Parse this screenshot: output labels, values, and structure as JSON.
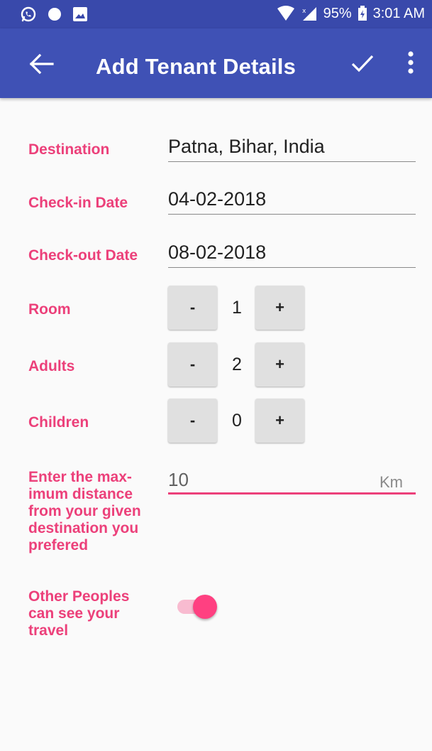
{
  "status_bar": {
    "battery": "95%",
    "time": "3:01 AM"
  },
  "toolbar": {
    "title": "Add Tenant Details"
  },
  "form": {
    "destination": {
      "label": "Destination",
      "value": "Patna, Bihar, India"
    },
    "checkin": {
      "label": "Check-in Date",
      "value": "04-02-2018"
    },
    "checkout": {
      "label": "Check-out Date",
      "value": "08-02-2018"
    },
    "room": {
      "label": "Room",
      "value": "1",
      "minus": "-",
      "plus": "+"
    },
    "adults": {
      "label": "Adults",
      "value": "2",
      "minus": "-",
      "plus": "+"
    },
    "children": {
      "label": "Children",
      "value": "0",
      "minus": "-",
      "plus": "+"
    },
    "distance": {
      "label_lines": [
        "Enter the max-",
        "imum distance",
        "from your given",
        "destination you",
        "prefered"
      ],
      "value": "10",
      "unit": "Km"
    },
    "visibility": {
      "label_lines": [
        "Other Peoples",
        "can see your",
        "travel"
      ],
      "enabled": true
    }
  },
  "colors": {
    "primary": "#3f51b5",
    "primary_dark": "#3949ab",
    "accent": "#ff4081",
    "label": "#ec407a"
  }
}
